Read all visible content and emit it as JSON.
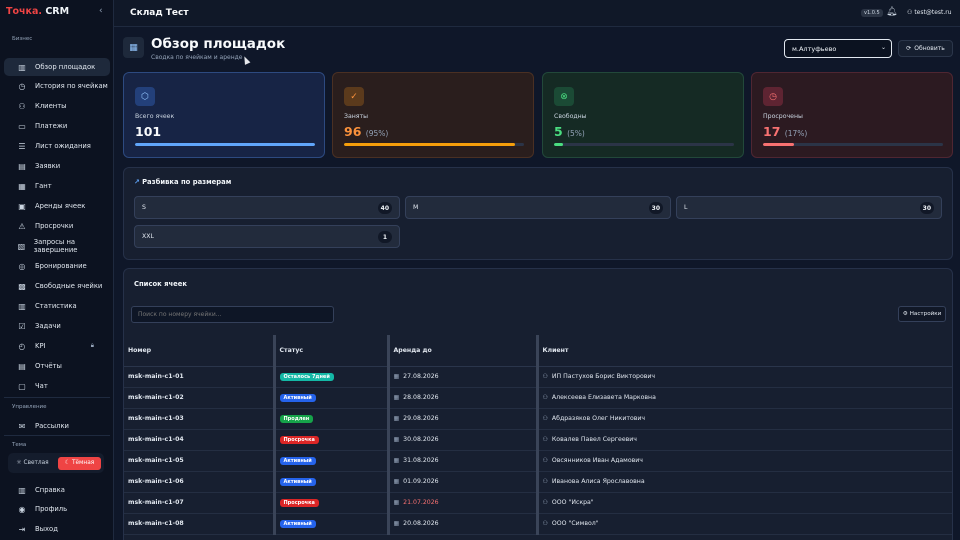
{
  "app": {
    "brand_name": "Точка.",
    "brand_suffix": "CRM"
  },
  "sidebar": {
    "section_business": "Бизнес",
    "items": [
      {
        "label": "Обзор площадок",
        "icon": "chart-bars-icon",
        "active": true
      },
      {
        "label": "История по ячейкам",
        "icon": "clock-icon"
      },
      {
        "label": "Клиенты",
        "icon": "users-icon"
      },
      {
        "label": "Платежи",
        "icon": "card-icon"
      },
      {
        "label": "Лист ожидания",
        "icon": "list-icon"
      },
      {
        "label": "Заявки",
        "icon": "document-icon"
      },
      {
        "label": "Гант",
        "icon": "calendar-icon"
      },
      {
        "label": "Аренды ячеек",
        "icon": "box-icon"
      },
      {
        "label": "Просрочки",
        "icon": "warning-icon"
      },
      {
        "label": "Запросы на завершение",
        "icon": "clipboard-icon"
      },
      {
        "label": "Бронирование",
        "icon": "target-icon"
      },
      {
        "label": "Свободные ячейки",
        "icon": "grid-icon"
      },
      {
        "label": "Статистика",
        "icon": "stats-icon"
      },
      {
        "label": "Задачи",
        "icon": "tasks-icon"
      },
      {
        "label": "KPI",
        "icon": "kpi-icon",
        "locked": true
      },
      {
        "label": "Отчёты",
        "icon": "report-icon"
      },
      {
        "label": "Чат",
        "icon": "chat-icon"
      }
    ],
    "section_manage": "Управление",
    "manage_items": [
      {
        "label": "Рассылки",
        "icon": "mail-icon"
      }
    ],
    "section_theme": "Тема",
    "theme_light": "Светлая",
    "theme_dark": "Тёмная",
    "bottom_items": [
      {
        "label": "Справка",
        "icon": "help-icon"
      },
      {
        "label": "Профиль",
        "icon": "profile-icon"
      },
      {
        "label": "Выход",
        "icon": "logout-icon"
      }
    ]
  },
  "header": {
    "title": "Склад Тест",
    "version": "v1.0.5",
    "user": "test@test.ru"
  },
  "page": {
    "title": "Обзор площадок",
    "subtitle": "Сводка по ячейкам и аренде",
    "location": "м.Алтуфьево",
    "refresh_label": "Обновить"
  },
  "stats": {
    "total": {
      "label": "Всего ячеек",
      "value": "101",
      "percent": "",
      "progress": 1.0
    },
    "occupied": {
      "label": "Заняты",
      "value": "96",
      "percent": "(95%)",
      "progress": 0.95
    },
    "free": {
      "label": "Свободны",
      "value": "5",
      "percent": "(5%)",
      "progress": 0.05
    },
    "overdue": {
      "label": "Просрочены",
      "value": "17",
      "percent": "(17%)",
      "progress": 0.17
    }
  },
  "sizes": {
    "title": "Разбивка по размерам",
    "items": [
      {
        "name": "S",
        "count": "40"
      },
      {
        "name": "M",
        "count": "30"
      },
      {
        "name": "L",
        "count": "30"
      },
      {
        "name": "XXL",
        "count": "1"
      }
    ]
  },
  "cells": {
    "title": "Список ячеек",
    "search_placeholder": "Поиск по номеру ячейки...",
    "settings_label": "Настройки",
    "columns": [
      "Номер",
      "Статус",
      "Аренда до",
      "Клиент"
    ],
    "rows": [
      {
        "number": "msk-main-c1-01",
        "status": "Осталось 7дней",
        "status_color": "#14b8a6",
        "until": "27.08.2026",
        "client": "ИП Пастухов Борис Викторович"
      },
      {
        "number": "msk-main-c1-02",
        "status": "Активный",
        "status_color": "#2563eb",
        "until": "28.08.2026",
        "client": "Алексеева Елизавета Марковна"
      },
      {
        "number": "msk-main-c1-03",
        "status": "Продлен",
        "status_color": "#16a34a",
        "until": "29.08.2026",
        "client": "Абдразяков Олег Никитович"
      },
      {
        "number": "msk-main-c1-04",
        "status": "Просрочка",
        "status_color": "#dc2626",
        "until": "30.08.2026",
        "client": "Ковалев Павел Сергеевич"
      },
      {
        "number": "msk-main-c1-05",
        "status": "Активный",
        "status_color": "#2563eb",
        "until": "31.08.2026",
        "client": "Овсянников Иван Адамович"
      },
      {
        "number": "msk-main-c1-06",
        "status": "Активный",
        "status_color": "#2563eb",
        "until": "01.09.2026",
        "client": "Иванова Алиса Ярославовна"
      },
      {
        "number": "msk-main-c1-07",
        "status": "Просрочка",
        "status_color": "#dc2626",
        "until": "21.07.2026",
        "until_overdue": true,
        "client": "ООО \"Искра\""
      },
      {
        "number": "msk-main-c1-08",
        "status": "Активный",
        "status_color": "#2563eb",
        "until": "20.08.2026",
        "client": "ООО \"Символ\""
      }
    ]
  }
}
